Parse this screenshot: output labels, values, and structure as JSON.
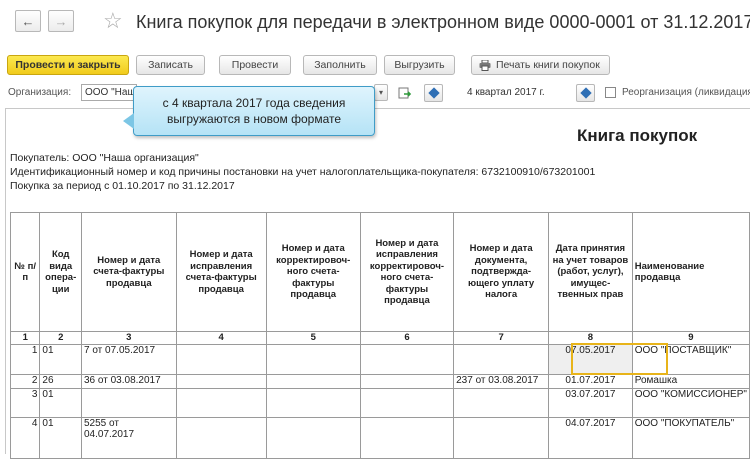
{
  "window": {
    "title": "Книга покупок для передачи в электронном виде 0000-0001 от 31.12.2017"
  },
  "toolbar": {
    "post_close": "Провести и закрыть",
    "save": "Записать",
    "post": "Провести",
    "fill": "Заполнить",
    "export": "Выгрузить",
    "print": "Печать книги покупок"
  },
  "filters": {
    "org_label": "Организация:",
    "org_value": "ООО \"Наша организация\"",
    "period": "4 квартал 2017 г.",
    "reorg_label": "Реорганизация (ликвидация)"
  },
  "tooltip": {
    "line1": "с 4 квартала 2017 года сведения",
    "line2": "выгружаются в новом формате"
  },
  "report": {
    "title": "Книга покупок",
    "buyer": "Покупатель:  ООО \"Наша организация\"",
    "inn": "Идентификационный номер и код причины постановки на учет налогоплательщика-покупателя:  6732100910/673201001",
    "period": "Покупка за период с 01.10.2017 по 31.12.2017",
    "headers": [
      "№ п/п",
      "Код вида опера- ции",
      "Номер и дата счета-фактуры продавца",
      "Номер и дата исправления счета-фактуры продавца",
      "Номер и дата корректировоч- ного счета-фактуры продавца",
      "Номер и дата исправления корректировоч- ного счета-фактуры продавца",
      "Номер и дата документа, подтвержда- ющего уплату налога",
      "Дата принятия на учет товаров (работ, услуг), имущес- твенных прав",
      "Наименование продавца"
    ],
    "col_numbers": [
      "1",
      "2",
      "3",
      "4",
      "5",
      "6",
      "7",
      "8",
      "9"
    ],
    "rows": [
      {
        "n": "1",
        "code": "01",
        "invoice": "7 от 07.05.2017",
        "fix": "",
        "corr": "",
        "corrfix": "",
        "payment": "",
        "date": "07.05.2017",
        "seller": "ООО \"ПОСТАВЩИК\""
      },
      {
        "n": "2",
        "code": "26",
        "invoice": "36 от 03.08.2017",
        "fix": "",
        "corr": "",
        "corrfix": "",
        "payment": "237 от 03.08.2017",
        "date": "01.07.2017",
        "seller": "Ромашка"
      },
      {
        "n": "3",
        "code": "01",
        "invoice": "",
        "fix": "",
        "corr": "",
        "corrfix": "",
        "payment": "",
        "date": "03.07.2017",
        "seller": "ООО \"КОМИССИОНЕР\""
      },
      {
        "n": "4",
        "code": "01",
        "invoice": "5255 от 04.07.2017",
        "fix": "",
        "corr": "",
        "corrfix": "",
        "payment": "",
        "date": "04.07.2017",
        "seller": "ООО \"ПОКУПАТЕЛЬ\""
      }
    ]
  },
  "colors": {
    "primary_button": "#f1cb1c",
    "tooltip_bg": "#b5e3f6",
    "highlight_border": "#e8b41a"
  }
}
